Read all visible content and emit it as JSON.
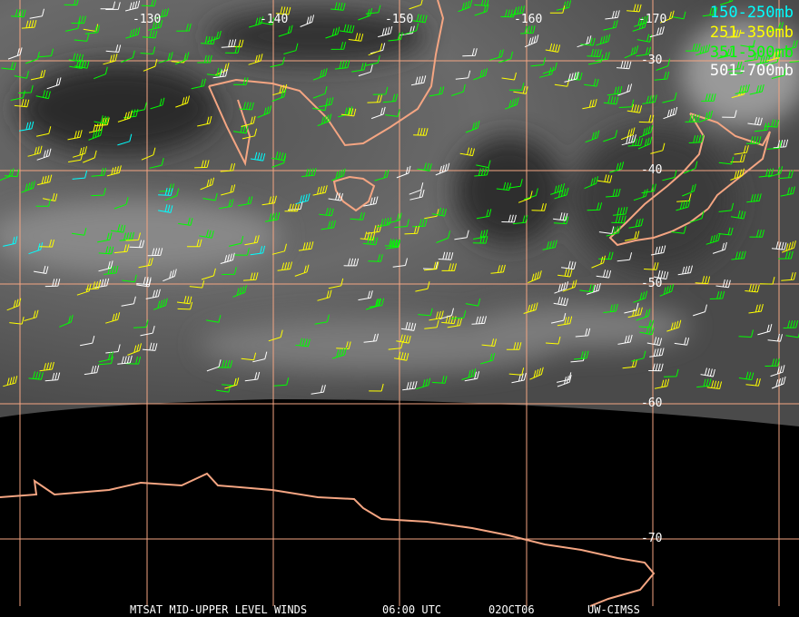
{
  "title_bar": {
    "product": "MTSAT MID-UPPER LEVEL WINDS",
    "time": "06:00 UTC",
    "date": "02OCT06",
    "source": "UW-CIMSS"
  },
  "legend": [
    {
      "label": "150-250mb",
      "color": "#00ffff"
    },
    {
      "label": "251-350mb",
      "color": "#ffff00"
    },
    {
      "label": "351-500mb",
      "color": "#00ff00"
    },
    {
      "label": "501-700mb",
      "color": "#ffffff"
    }
  ],
  "longitude_labels": [
    "-130",
    "-140",
    "-150",
    "-160",
    "-170"
  ],
  "latitude_labels": [
    "-30",
    "-40",
    "-50",
    "-60",
    "-70"
  ],
  "colors": {
    "grid": "#f4a582",
    "coast": "#f4a582",
    "background": "#000000"
  }
}
